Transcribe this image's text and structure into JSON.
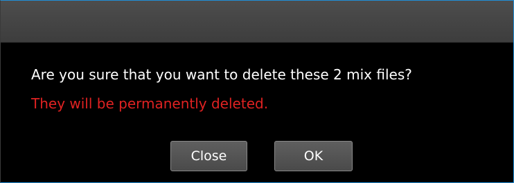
{
  "dialog": {
    "message": "Are you sure that you want to delete these 2 mix files?",
    "warning": "They will be permanently deleted.",
    "close_label": "Close",
    "ok_label": "OK"
  },
  "colors": {
    "background": "#000000",
    "titlebar": "#454545",
    "text": "#ffffff",
    "warning": "#e02222",
    "button": "#555555"
  }
}
